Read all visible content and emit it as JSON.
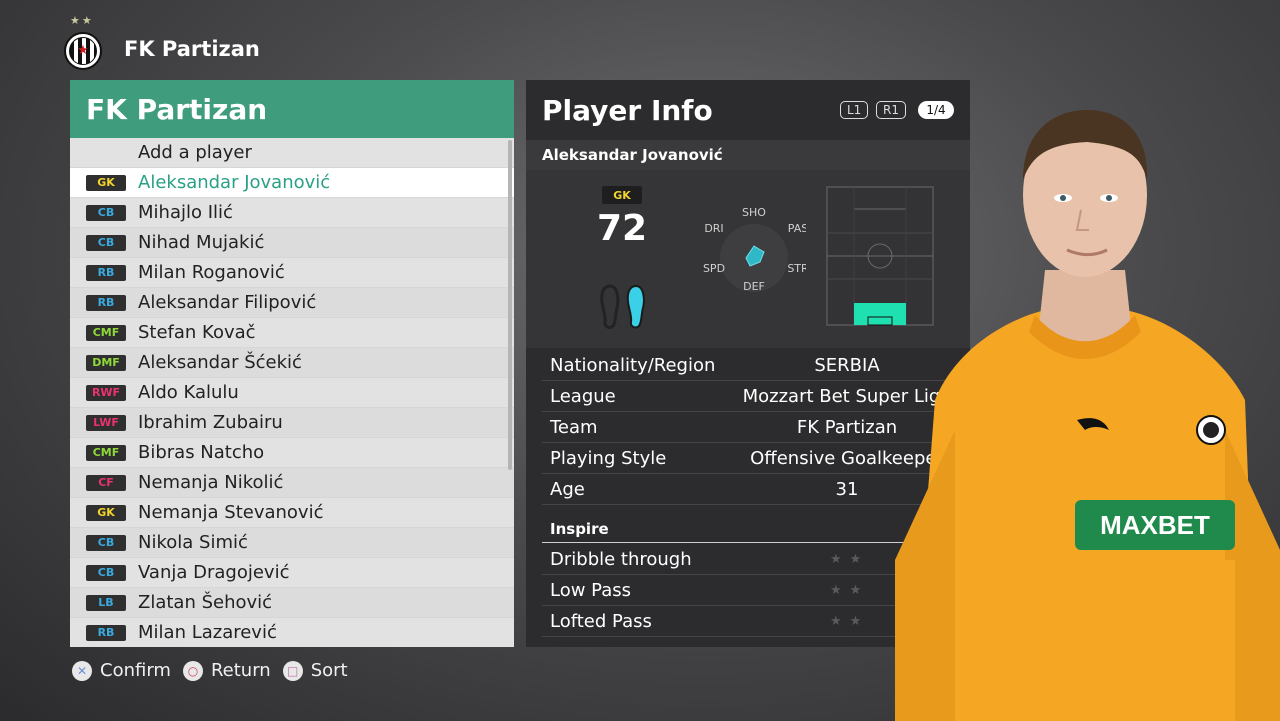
{
  "club": {
    "name": "FK Partizan"
  },
  "list": {
    "title": "FK Partizan",
    "add_label": "Add a player",
    "players": [
      {
        "pos": "GK",
        "type": "gk",
        "name": "Aleksandar Jovanović",
        "selected": true
      },
      {
        "pos": "CB",
        "type": "def",
        "name": "Mihajlo Ilić"
      },
      {
        "pos": "CB",
        "type": "def",
        "name": "Nihad Mujakić"
      },
      {
        "pos": "RB",
        "type": "def",
        "name": "Milan Roganović"
      },
      {
        "pos": "RB",
        "type": "def",
        "name": "Aleksandar Filipović"
      },
      {
        "pos": "CMF",
        "type": "mid",
        "name": "Stefan Kovač"
      },
      {
        "pos": "DMF",
        "type": "mid",
        "name": "Aleksandar Šćekić"
      },
      {
        "pos": "RWF",
        "type": "fwd",
        "name": "Aldo Kalulu"
      },
      {
        "pos": "LWF",
        "type": "fwd",
        "name": "Ibrahim Zubairu"
      },
      {
        "pos": "CMF",
        "type": "mid",
        "name": "Bibras Natcho"
      },
      {
        "pos": "CF",
        "type": "fwd",
        "name": "Nemanja Nikolić"
      },
      {
        "pos": "GK",
        "type": "gk",
        "name": "Nemanja Stevanović"
      },
      {
        "pos": "CB",
        "type": "def",
        "name": "Nikola Simić"
      },
      {
        "pos": "CB",
        "type": "def",
        "name": "Vanja Dragojević"
      },
      {
        "pos": "LB",
        "type": "def",
        "name": "Zlatan Šehović"
      },
      {
        "pos": "RB",
        "type": "def",
        "name": "Milan Lazarević"
      }
    ]
  },
  "info": {
    "title": "Player Info",
    "l1": "L1",
    "r1": "R1",
    "page": "1/4",
    "player_name": "Aleksandar Jovanović",
    "position": "GK",
    "overall": "72",
    "radar_labels": {
      "sho": "SHO",
      "pas": "PAS",
      "str": "STR",
      "def": "DEF",
      "spd": "SPD",
      "dri": "DRI"
    },
    "attributes": [
      {
        "key": "Nationality/Region",
        "value": "SERBIA"
      },
      {
        "key": "League",
        "value": "Mozzart Bet Super Liga"
      },
      {
        "key": "Team",
        "value": "FK Partizan"
      },
      {
        "key": "Playing Style",
        "value": "Offensive Goalkeeper"
      },
      {
        "key": "Age",
        "value": "31"
      }
    ],
    "inspire_title": "Inspire",
    "inspire": [
      {
        "key": "Dribble through",
        "stars": "★★"
      },
      {
        "key": "Low Pass",
        "stars": "★★"
      },
      {
        "key": "Lofted Pass",
        "stars": "★★"
      }
    ]
  },
  "kit": {
    "sponsor": "MAXBET",
    "color": "#f5a623"
  },
  "footer": {
    "confirm": "Confirm",
    "return": "Return",
    "sort": "Sort"
  },
  "colors": {
    "accent": "#3f9c7c",
    "selected_text": "#2aa086",
    "gk": "#f2d32b",
    "def": "#39a9e0",
    "mid": "#8fd93a",
    "fwd": "#e8336f",
    "pitch_highlight": "#1ee0b0"
  }
}
